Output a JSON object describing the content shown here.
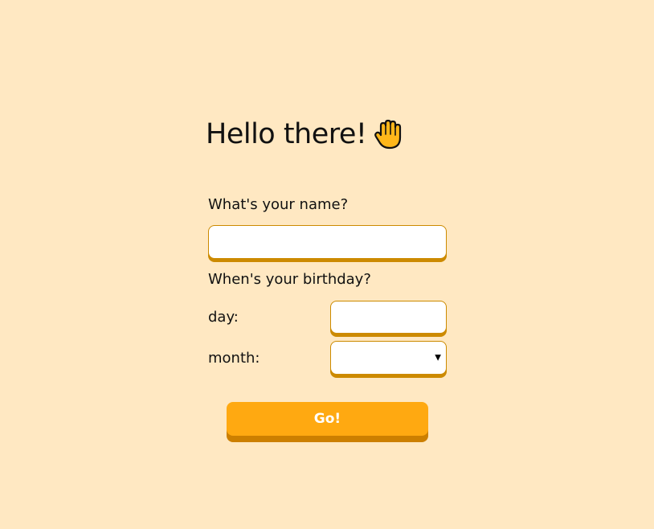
{
  "header": {
    "title": "Hello there!",
    "icon": "raised-hand-icon"
  },
  "form": {
    "name_label": "What's your name?",
    "name_value": "",
    "birthday_label": "When's your birthday?",
    "day_label": "day:",
    "day_value": "",
    "month_label": "month:",
    "month_value": "",
    "submit_label": "Go!"
  },
  "colors": {
    "background": "#ffe8c2",
    "accent": "#ffa911",
    "accent_shadow": "#cc7f00",
    "field_border": "#cc8a00"
  }
}
